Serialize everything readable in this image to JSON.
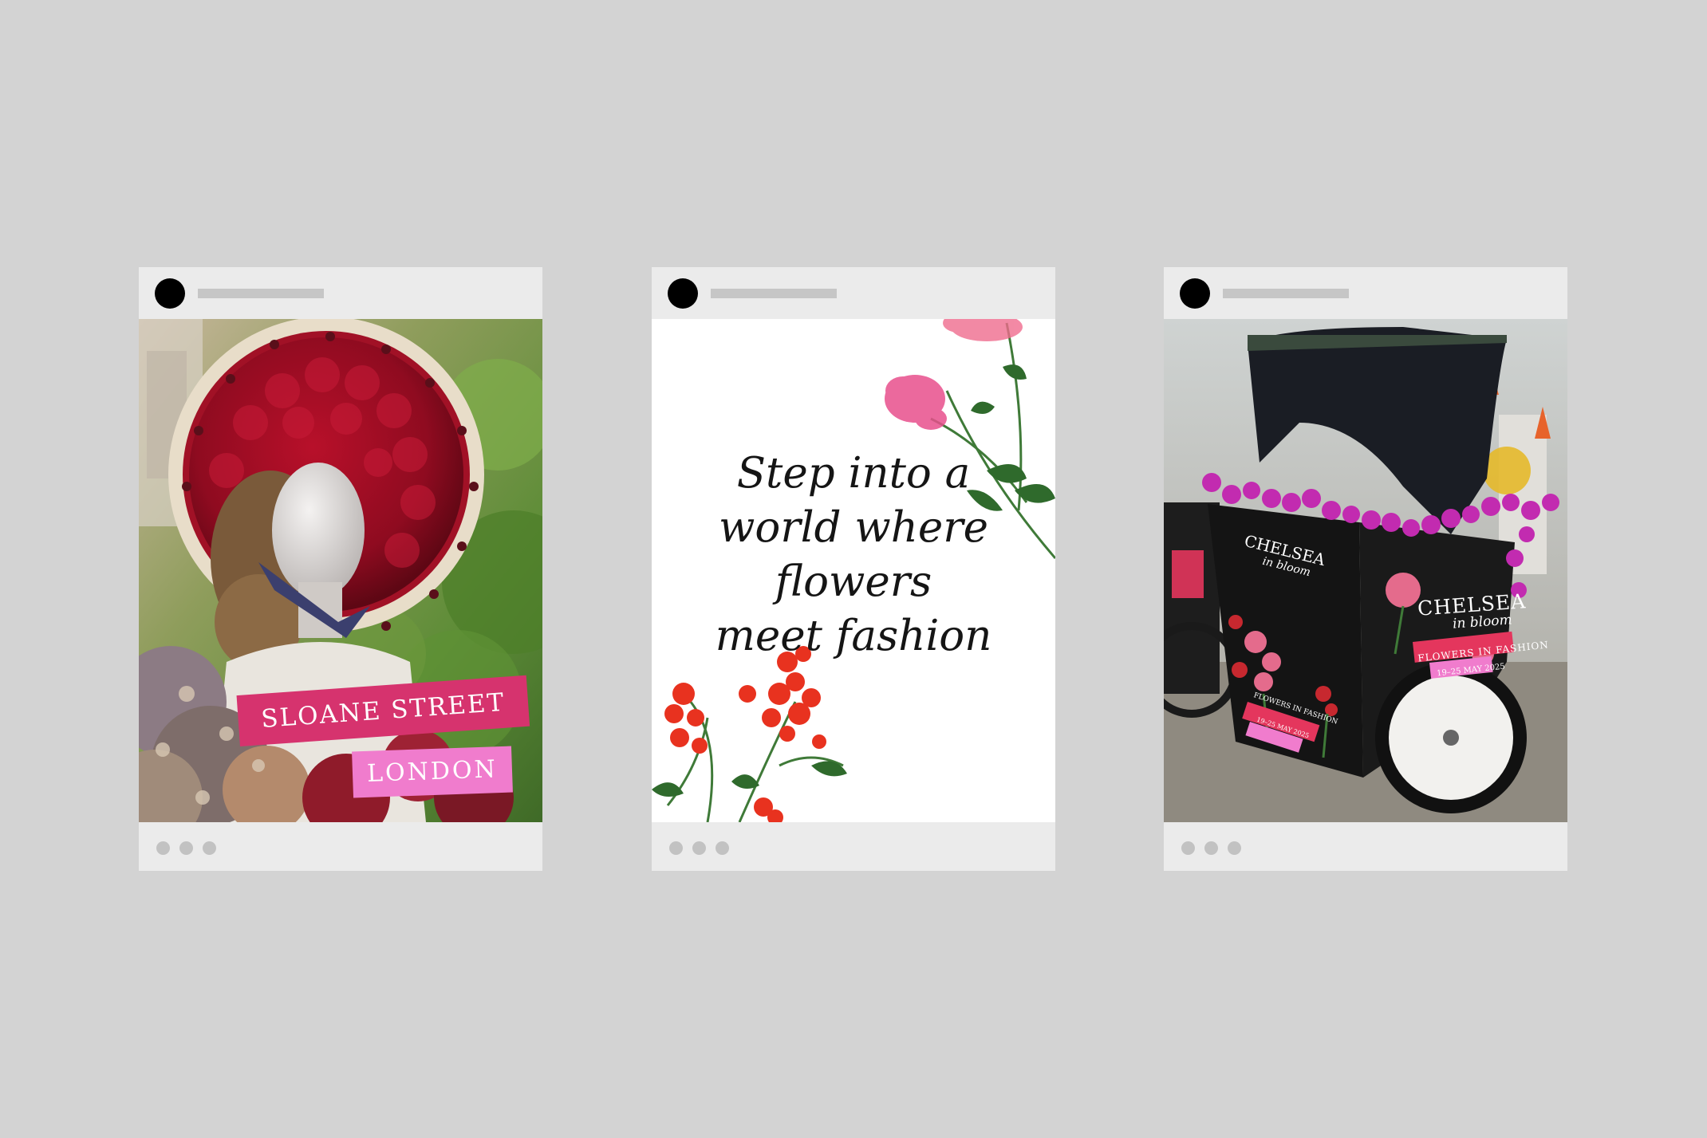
{
  "posts": [
    {
      "id": "sloane",
      "tag_line1": "SLOANE STREET",
      "tag_line2": "LONDON"
    },
    {
      "id": "quote",
      "quote_lines": [
        "Step into a",
        "world where",
        "flowers",
        "meet fashion"
      ]
    },
    {
      "id": "rickshaw",
      "panel_brand": "CHELSEA",
      "panel_brand_sub": "in bloom",
      "panel_tag": "FLOWERS IN FASHION",
      "panel_dates": "19–25 MAY 2025",
      "side_brand": "CHELSEA",
      "side_brand_sub": "in bloom",
      "side_tag": "FLOWERS IN FASHION",
      "side_dates": "19–25 MAY 2025"
    }
  ],
  "colors": {
    "background": "#d3d3d3",
    "card": "#ebebeb",
    "placeholder": "#c6c6c6",
    "avatar": "#000000",
    "tag_pink": "#d6336e",
    "tag_light_pink": "#f07ccd"
  }
}
